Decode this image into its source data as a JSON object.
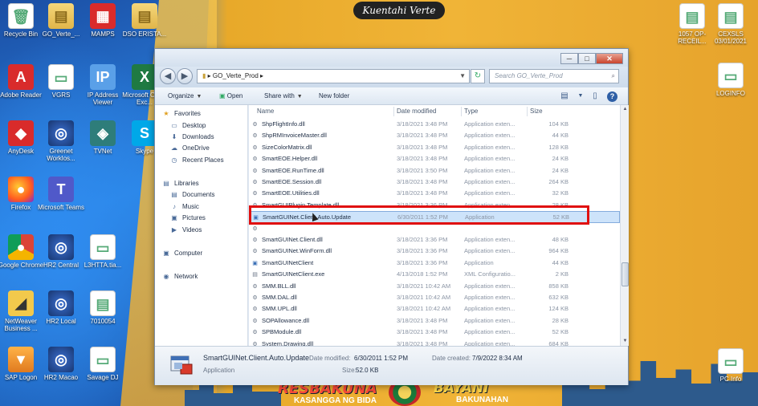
{
  "banner": "Kuentahi Verte",
  "campaign": {
    "left": "RESBAKUNA",
    "left_sub": "KASANGGA NG BIDA",
    "right": "BAYANI",
    "right_sub": "BAKUNAHAN"
  },
  "desktop_icons": [
    {
      "label": "Recycle Bin",
      "glyph": "🗑",
      "style": "g-doc"
    },
    {
      "label": "GO_Verte_...",
      "glyph": "▤",
      "style": "g-folder"
    },
    {
      "label": "MAMPS",
      "glyph": "▦",
      "style": "g-red"
    },
    {
      "label": "DSO ERISTA...",
      "glyph": "▤",
      "style": "g-folder"
    },
    {
      "label": "Adobe Reader",
      "glyph": "A",
      "style": "g-red"
    },
    {
      "label": "VGRS",
      "glyph": "▭",
      "style": "g-doc"
    },
    {
      "label": "IP Address Viewer",
      "glyph": "IP",
      "style": "g-ie"
    },
    {
      "label": "Microsoft Office Exc...",
      "glyph": "X",
      "style": "g-excel"
    },
    {
      "label": "AnyDesk",
      "glyph": "◆",
      "style": "g-red"
    },
    {
      "label": "Greenet Worklos...",
      "glyph": "◎",
      "style": "g-globe"
    },
    {
      "label": "TVNet",
      "glyph": "◈",
      "style": "g-app"
    },
    {
      "label": "Skype",
      "glyph": "S",
      "style": "g-skype"
    },
    {
      "label": "Firefox",
      "glyph": "●",
      "style": "g-firefox"
    },
    {
      "label": "Microsoft Teams",
      "glyph": "T",
      "style": "g-teams"
    },
    {
      "label": "Google Chrome",
      "glyph": "●",
      "style": "g-chrome"
    },
    {
      "label": "HR2 Central",
      "glyph": "◎",
      "style": "g-globe"
    },
    {
      "label": "L3HTTA.tia...",
      "glyph": "▭",
      "style": "g-doc"
    },
    {
      "label": "NetWeaver Business ...",
      "glyph": "◢",
      "style": "g-nw"
    },
    {
      "label": "HR2 Local",
      "glyph": "◎",
      "style": "g-globe"
    },
    {
      "label": "7010054",
      "glyph": "▤",
      "style": "g-doc"
    },
    {
      "label": "SAP Logon",
      "glyph": "▼",
      "style": "g-sap"
    },
    {
      "label": "HR2 Macao",
      "glyph": "◎",
      "style": "g-globe"
    },
    {
      "label": "Savage DJ",
      "glyph": "▭",
      "style": "g-doc"
    },
    {
      "label": "1057 OP-RECEIL...",
      "glyph": "▤",
      "style": "g-doc"
    },
    {
      "label": "CEXSLS 03/01/2021",
      "glyph": "▤",
      "style": "g-doc"
    },
    {
      "label": "LOGINFO",
      "glyph": "▭",
      "style": "g-doc"
    },
    {
      "label": "PC Info",
      "glyph": "▭",
      "style": "g-doc"
    }
  ],
  "explorer": {
    "window_controls": {
      "minimize": "─",
      "maximize": "□",
      "close": "✕"
    },
    "nav": {
      "back": "◀",
      "forward": "▶"
    },
    "address": "GO_Verte_Prod",
    "address_prefix": "▸",
    "refresh": "↻",
    "search_placeholder": "Search GO_Verte_Prod",
    "toolbar": {
      "organize": "Organize",
      "open": "Open",
      "share_with": "Share with",
      "new_folder": "New folder",
      "dropdown": "▼"
    },
    "navpane": [
      {
        "label": "Favorites",
        "glyph": "★"
      },
      {
        "label": "Desktop",
        "glyph": "▭"
      },
      {
        "label": "Downloads",
        "glyph": "⬇"
      },
      {
        "label": "OneDrive",
        "glyph": "☁"
      },
      {
        "label": "Recent Places",
        "glyph": "◷"
      },
      {
        "label": "Libraries",
        "glyph": "▤"
      },
      {
        "label": "Documents",
        "glyph": "▤"
      },
      {
        "label": "Music",
        "glyph": "♪"
      },
      {
        "label": "Pictures",
        "glyph": "▣"
      },
      {
        "label": "Videos",
        "glyph": "▶"
      },
      {
        "label": "Computer",
        "glyph": "▣"
      },
      {
        "label": "Network",
        "glyph": "◉"
      }
    ],
    "columns": {
      "name": "Name",
      "date": "Date modified",
      "type": "Type",
      "size": "Size"
    },
    "files": [
      {
        "name": "ShpFlightInfo.dll",
        "date": "3/18/2021 3:48 PM",
        "type": "Application exten...",
        "size": "104 KB",
        "glyph": "⚙"
      },
      {
        "name": "ShpRMInvoiceMaster.dll",
        "date": "3/18/2021 3:48 PM",
        "type": "Application exten...",
        "size": "44 KB",
        "glyph": "⚙"
      },
      {
        "name": "SizeColorMatrix.dll",
        "date": "3/18/2021 3:48 PM",
        "type": "Application exten...",
        "size": "128 KB",
        "glyph": "⚙"
      },
      {
        "name": "SmartEOE.Helper.dll",
        "date": "3/18/2021 3:48 PM",
        "type": "Application exten...",
        "size": "24 KB",
        "glyph": "⚙"
      },
      {
        "name": "SmartEOE.RunTime.dll",
        "date": "3/18/2021 3:50 PM",
        "type": "Application exten...",
        "size": "24 KB",
        "glyph": "⚙"
      },
      {
        "name": "SmartEOE.Session.dll",
        "date": "3/18/2021 3:48 PM",
        "type": "Application exten...",
        "size": "264 KB",
        "glyph": "⚙"
      },
      {
        "name": "SmartEOE.Utilities.dll",
        "date": "3/18/2021 3:48 PM",
        "type": "Application exten...",
        "size": "32 KB",
        "glyph": "⚙"
      },
      {
        "name": "SmartGUIPlugin.Template.dll",
        "date": "3/18/2021 3:36 PM",
        "type": "Application exten...",
        "size": "28 KB",
        "glyph": "⚙"
      },
      {
        "name": "SmartGUINet.Client.Auto.Update",
        "date": "6/30/2011 1:52 PM",
        "type": "Application",
        "size": "52 KB",
        "glyph": "▣",
        "selected": true
      },
      {
        "name": "",
        "date": "",
        "type": "",
        "size": "",
        "glyph": "⚙"
      },
      {
        "name": "SmartGUINet.Client.dll",
        "date": "3/18/2021 3:36 PM",
        "type": "Application exten...",
        "size": "48 KB",
        "glyph": "⚙"
      },
      {
        "name": "SmartGUINet.WinForm.dll",
        "date": "3/18/2021 3:36 PM",
        "type": "Application exten...",
        "size": "964 KB",
        "glyph": "⚙"
      },
      {
        "name": "SmartGUINetClient",
        "date": "3/18/2021 3:36 PM",
        "type": "Application",
        "size": "44 KB",
        "glyph": "▣"
      },
      {
        "name": "SmartGUINetClient.exe",
        "date": "4/13/2018 1:52 PM",
        "type": "XML Configuratio...",
        "size": "2 KB",
        "glyph": "▤"
      },
      {
        "name": "SMM.BLL.dll",
        "date": "3/18/2021 10:42 AM",
        "type": "Application exten...",
        "size": "858 KB",
        "glyph": "⚙"
      },
      {
        "name": "SMM.DAL.dll",
        "date": "3/18/2021 10:42 AM",
        "type": "Application exten...",
        "size": "632 KB",
        "glyph": "⚙"
      },
      {
        "name": "SMM.UPL.dll",
        "date": "3/18/2021 10:42 AM",
        "type": "Application exten...",
        "size": "124 KB",
        "glyph": "⚙"
      },
      {
        "name": "SOPAllowance.dll",
        "date": "3/18/2021 3:48 PM",
        "type": "Application exten...",
        "size": "28 KB",
        "glyph": "⚙"
      },
      {
        "name": "SPBModule.dll",
        "date": "3/18/2021 3:48 PM",
        "type": "Application exten...",
        "size": "52 KB",
        "glyph": "⚙"
      },
      {
        "name": "System.Drawing.dll",
        "date": "3/18/2021 3:48 PM",
        "type": "Application exten...",
        "size": "684 KB",
        "glyph": "⚙"
      }
    ],
    "details": {
      "name": "SmartGUINet.Client.Auto.Update",
      "type": "Application",
      "modified_label": "Date modified:",
      "modified": "6/30/2011 1:52 PM",
      "created_label": "Date created:",
      "created": "7/9/2022 8:34 AM",
      "size_label": "Size:",
      "size": "52.0 KB"
    }
  }
}
